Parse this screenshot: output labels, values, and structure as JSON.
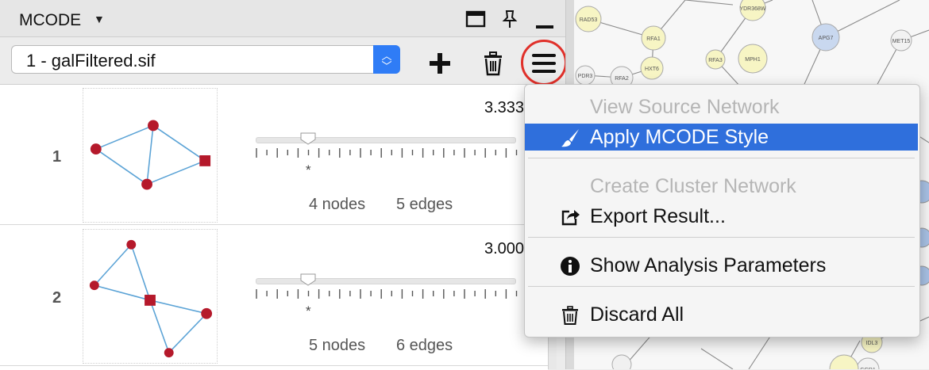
{
  "panel": {
    "title": "MCODE",
    "network_select": {
      "value": "1 - galFiltered.sif"
    }
  },
  "results": [
    {
      "rank": "1",
      "score": "3.333",
      "nodes_label": "4 nodes",
      "edges_label": "5 edges",
      "slider_marker": "*"
    },
    {
      "rank": "2",
      "score": "3.000",
      "nodes_label": "5 nodes",
      "edges_label": "6 edges",
      "slider_marker": "*"
    }
  ],
  "menu": {
    "items": [
      {
        "label": "View Source Network",
        "enabled": false
      },
      {
        "label": "Apply MCODE Style",
        "enabled": true,
        "icon": "paintbrush-icon",
        "highlighted": true
      },
      {
        "label": "Create Cluster Network",
        "enabled": false
      },
      {
        "label": "Export Result...",
        "enabled": true,
        "icon": "export-icon"
      },
      {
        "label": "Show Analysis Parameters",
        "enabled": true,
        "icon": "info-icon"
      },
      {
        "label": "Discard All",
        "enabled": true,
        "icon": "trash-icon"
      }
    ]
  },
  "canvas": {
    "node_labels": [
      "RAD53",
      "RFA1",
      "YDR368W",
      "APG7",
      "MET15",
      "HXT6",
      "MPH1",
      "PDR3",
      "RFA2",
      "RFA3",
      "CGR1",
      "IDL3"
    ]
  },
  "colors": {
    "accent": "#2f6fdc",
    "stepper": "#2f7cf6",
    "highlight_ring": "#e0302a",
    "node_red": "#b5192b",
    "edge_blue": "#5ba3d6",
    "canvas_node_yellow": "#f7f5c4",
    "canvas_node_blue": "#c9d8ef"
  }
}
